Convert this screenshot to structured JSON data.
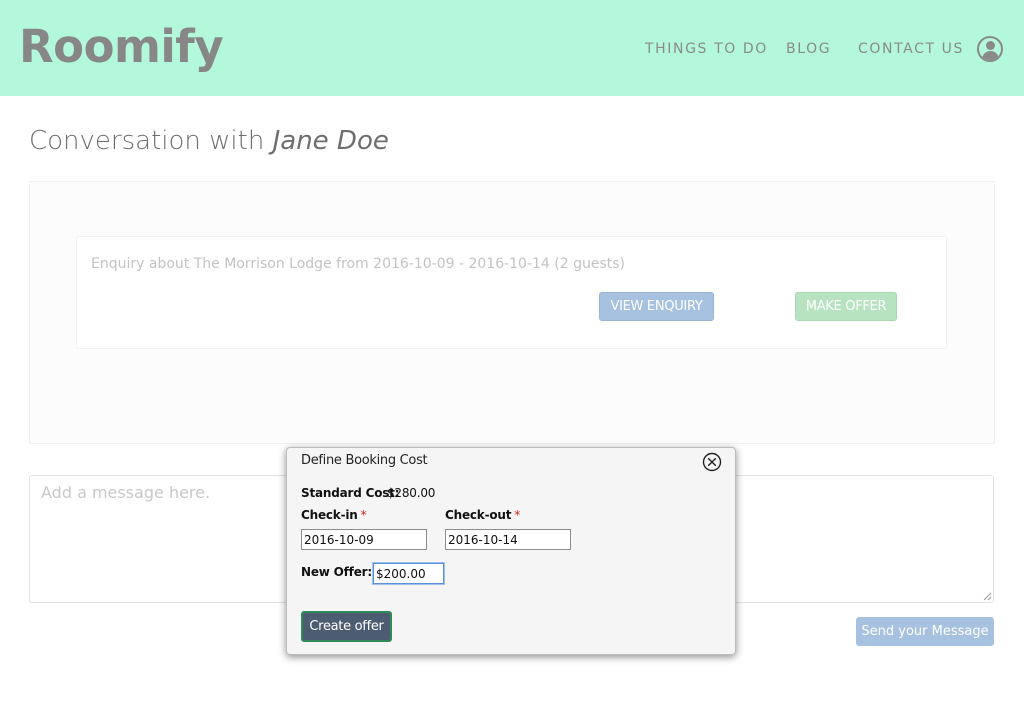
{
  "header": {
    "brand": "Roomify",
    "nav": [
      {
        "label": "THINGS TO DO"
      },
      {
        "label": "BLOG"
      },
      {
        "label": "CONTACT US"
      }
    ],
    "user_icon": "user-avatar-icon"
  },
  "page": {
    "title_prefix": "Conversation with ",
    "title_name": "Jane Doe"
  },
  "enquiry": {
    "text": "Enquiry about The Morrison Lodge from 2016-10-09 - 2016-10-14 (2 guests)",
    "view_label": "VIEW ENQUIRY",
    "offer_label": "MAKE OFFER"
  },
  "composer": {
    "placeholder": "Add a message here.",
    "send_label": "Send your Message"
  },
  "modal": {
    "title": "Define Booking Cost",
    "standard_cost_label": "Standard Cost:",
    "standard_cost_value": "$280.00",
    "checkin_label": "Check-in",
    "checkin_value": "2016-10-09",
    "checkout_label": "Check-out",
    "checkout_value": "2016-10-14",
    "new_offer_label": "New Offer:",
    "new_offer_value": "$200.00",
    "required_marker": "*",
    "create_label": "Create offer"
  },
  "colors": {
    "header_bg": "#b4f8dc",
    "view_button": "#a7c1e0",
    "offer_button": "#b7e3c1",
    "create_button": "#4c5d72",
    "required": "#e02020"
  }
}
